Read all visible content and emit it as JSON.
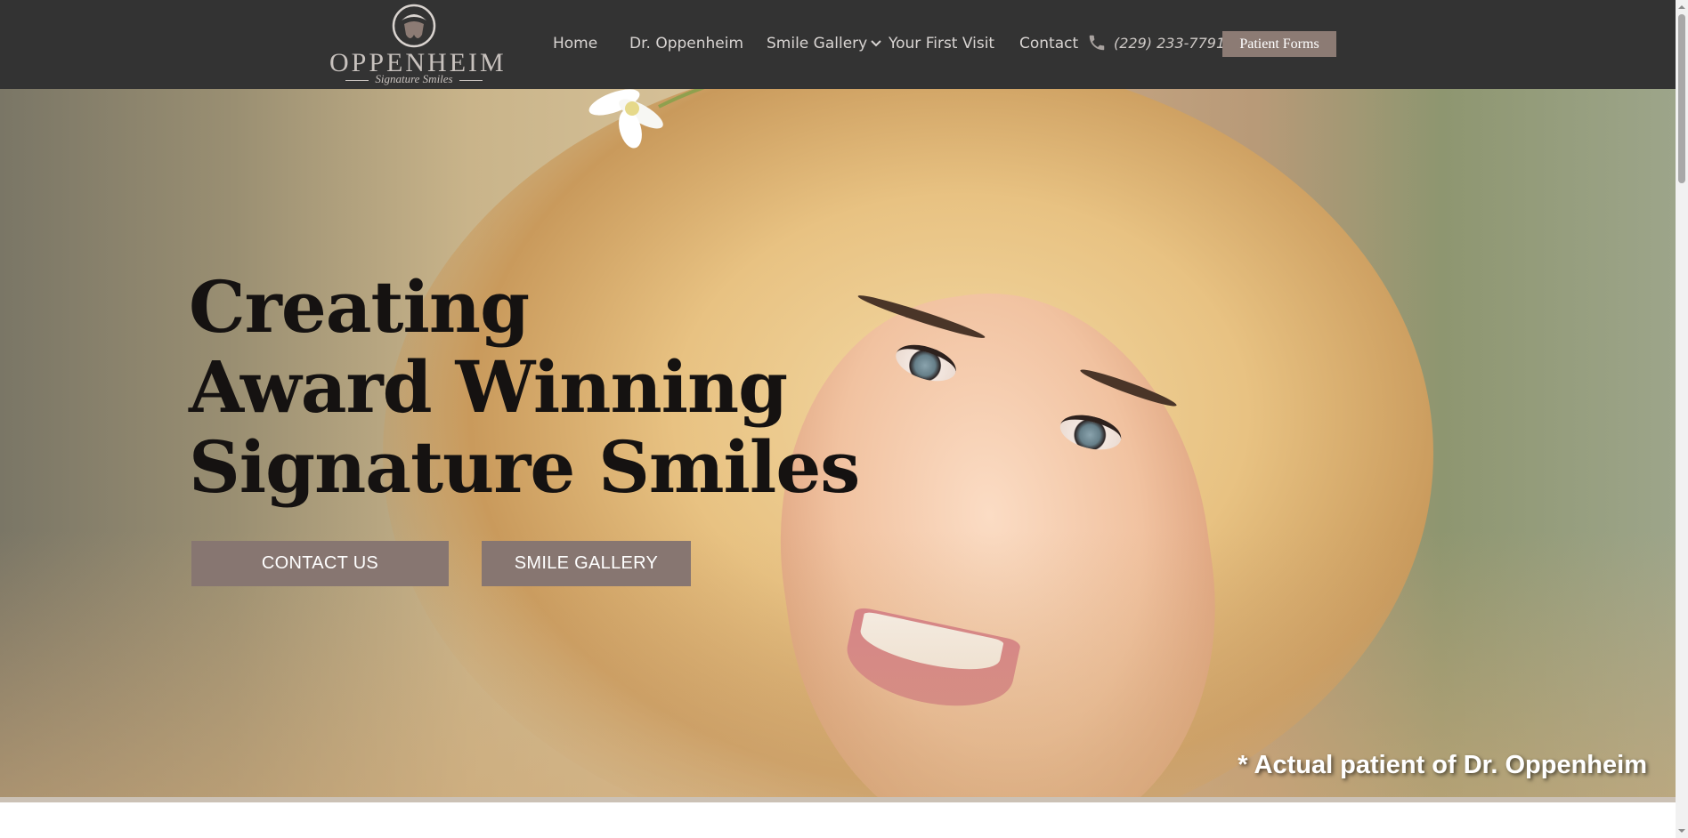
{
  "brand": {
    "name": "OPPENHEIM",
    "tagline": "Signature Smiles"
  },
  "nav": {
    "items": [
      {
        "label": "Home"
      },
      {
        "label": "Dr. Oppenheim"
      },
      {
        "label": "Smile Gallery"
      },
      {
        "label": "Your First Visit"
      },
      {
        "label": "Contact"
      }
    ],
    "phone": "(229) 233-7791",
    "forms_button": "Patient Forms"
  },
  "hero": {
    "headline": [
      "Creating",
      "Award Winning",
      "Signature Smiles"
    ],
    "contact_button": "CONTACT US",
    "gallery_button": "SMILE GALLERY",
    "disclaimer": "* Actual patient of Dr. Oppenheim"
  },
  "icons": {
    "phone": "phone-icon",
    "dropdown": "chevron-down-icon",
    "logo": "tooth-logo-icon"
  },
  "colors": {
    "header_bg": "#333333",
    "button_bg": "#877671",
    "forms_button_bg": "#8c7b74",
    "headline": "#151211"
  }
}
